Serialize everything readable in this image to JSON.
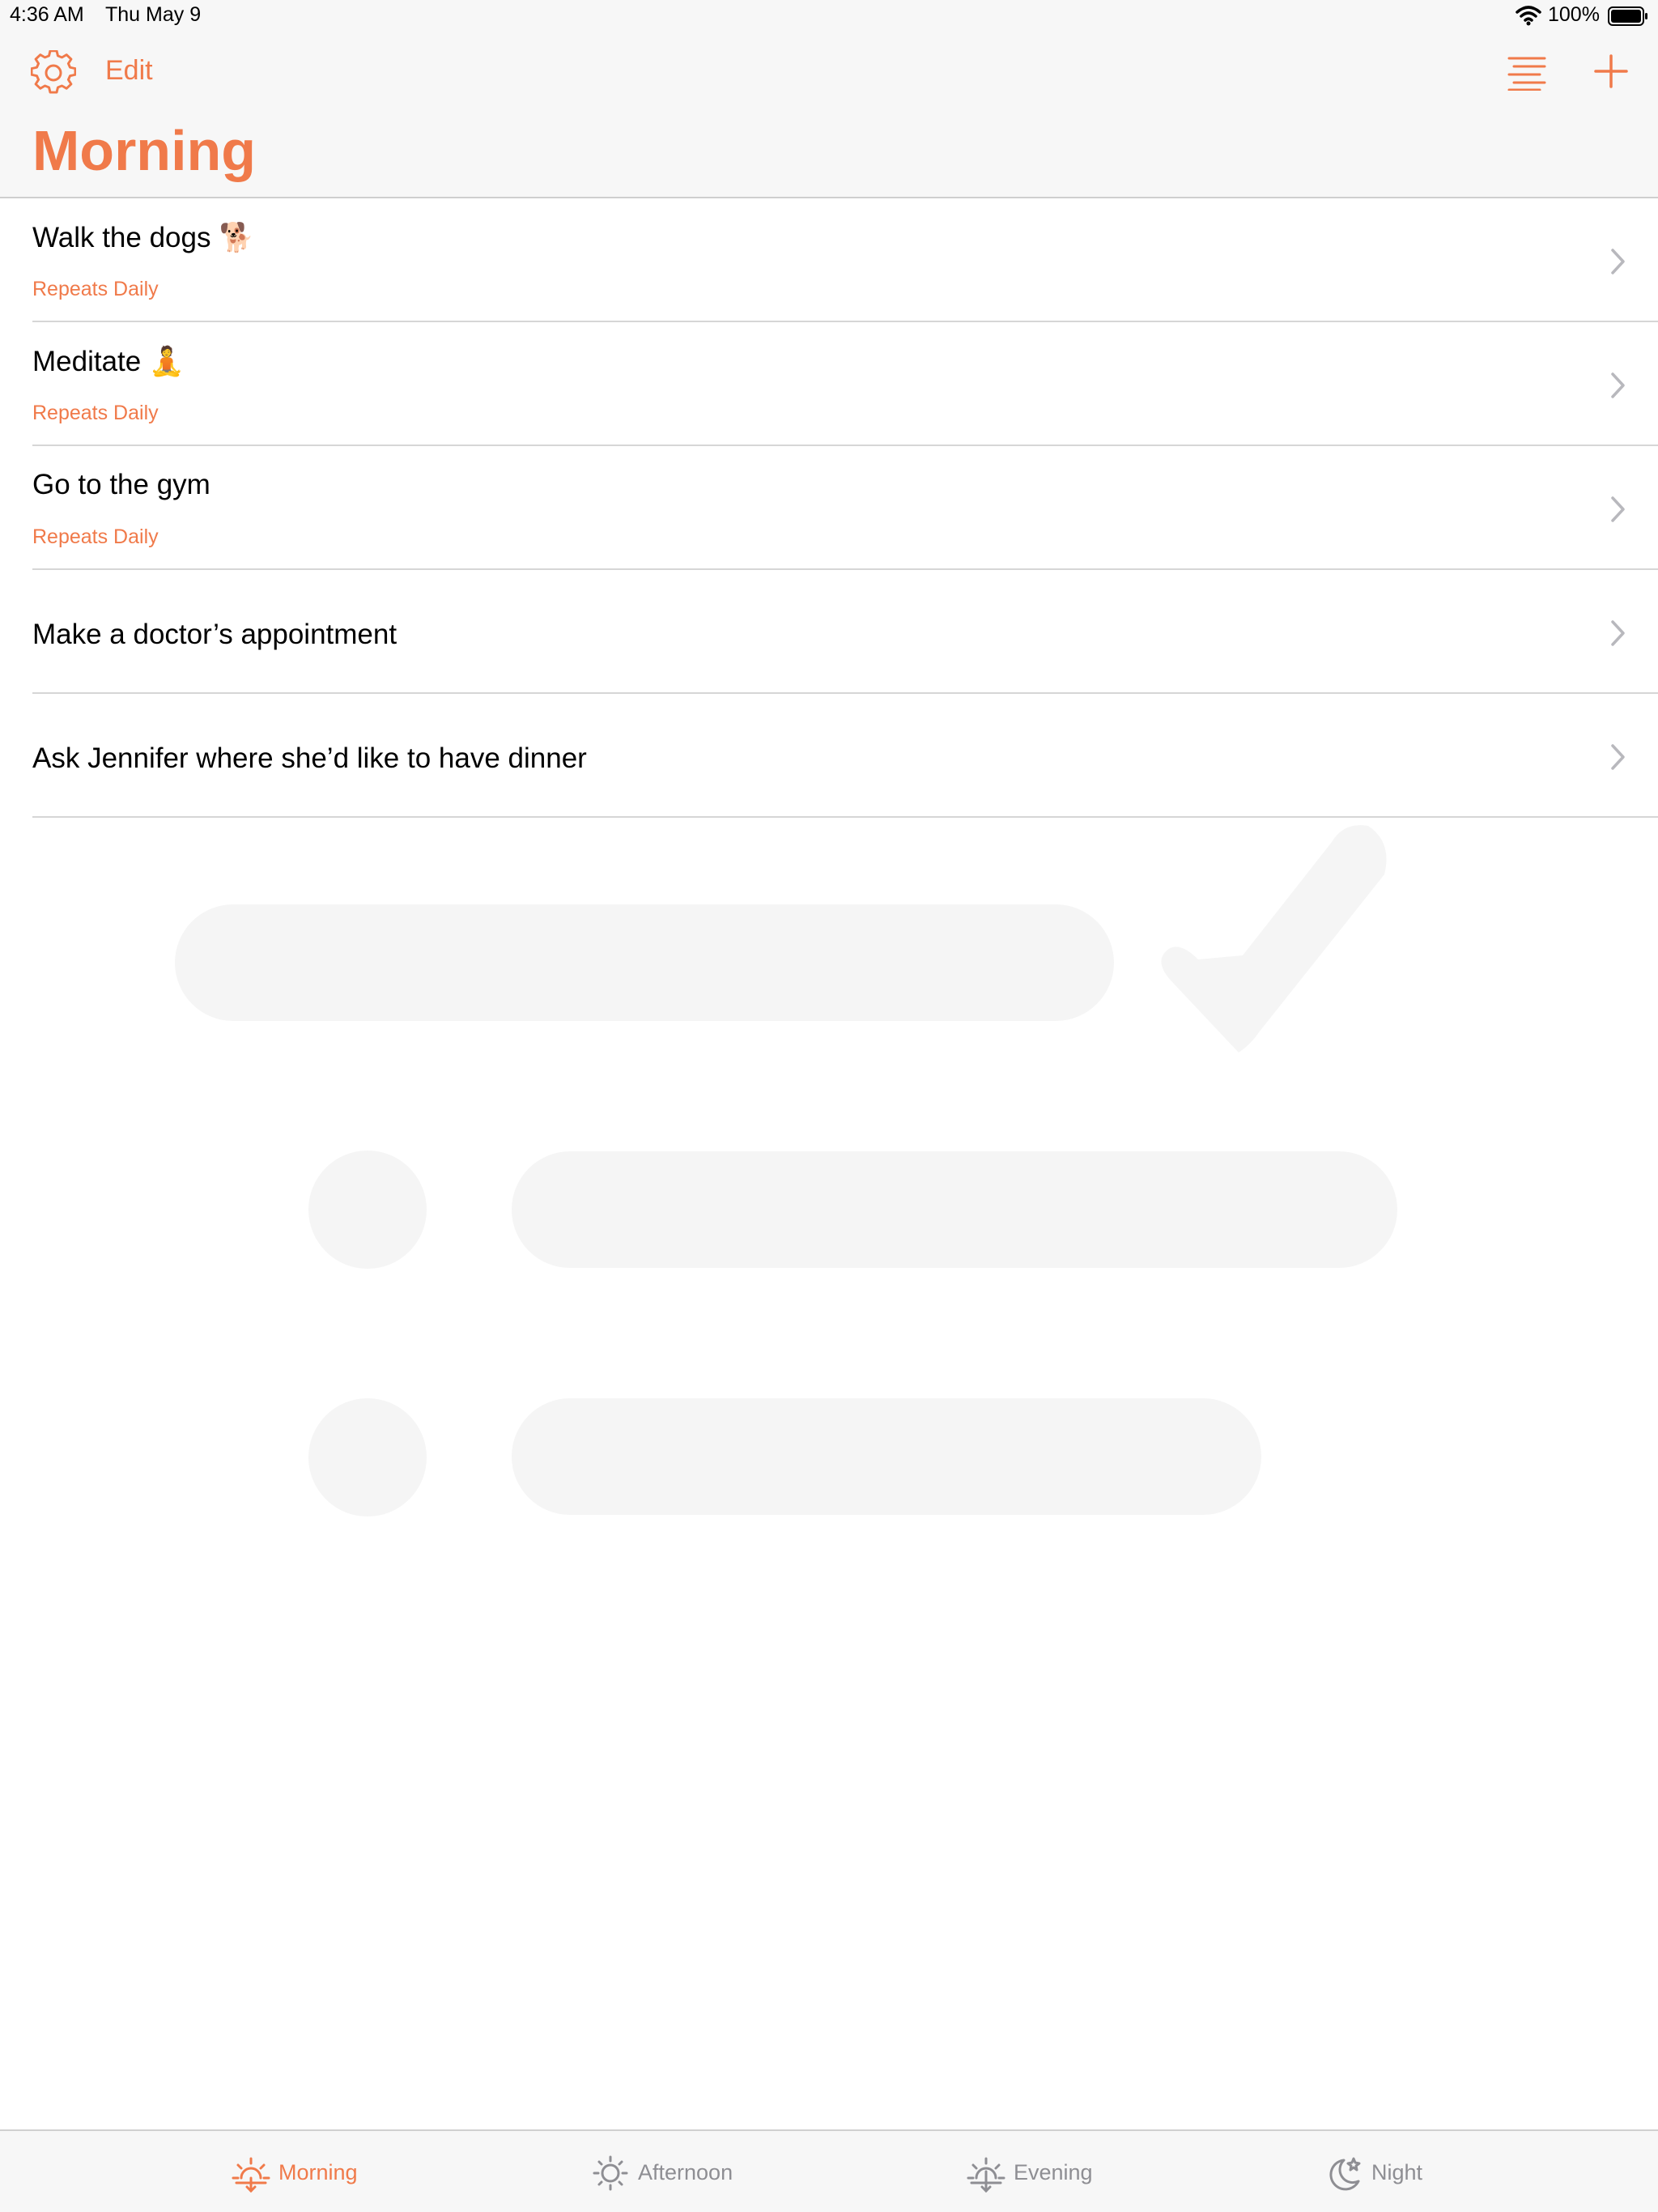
{
  "status_bar": {
    "time": "4:36 AM",
    "date": "Thu May 9",
    "battery_percent": "100%",
    "battery_level": 1.0,
    "icons": [
      "wifi-icon",
      "battery-icon"
    ]
  },
  "nav": {
    "settings_icon": "gear-icon",
    "edit_label": "Edit",
    "sort_icon": "list-sort-icon",
    "add_icon": "plus-icon",
    "title": "Morning"
  },
  "tasks": [
    {
      "title": "Walk the dogs",
      "emoji": "🐕",
      "subtitle": "Repeats Daily"
    },
    {
      "title": "Meditate",
      "emoji": "🧘",
      "subtitle": "Repeats Daily"
    },
    {
      "title": "Go to the gym",
      "emoji": "",
      "subtitle": "Repeats Daily"
    },
    {
      "title": "Make a doctor’s appointment",
      "emoji": "",
      "subtitle": ""
    },
    {
      "title": "Ask Jennifer where she’d like to have dinner",
      "emoji": "",
      "subtitle": ""
    }
  ],
  "tab_bar": {
    "tabs": [
      {
        "label": "Morning",
        "icon": "sunrise-icon",
        "active": true
      },
      {
        "label": "Afternoon",
        "icon": "sun-icon",
        "active": false
      },
      {
        "label": "Evening",
        "icon": "sunset-icon",
        "active": false
      },
      {
        "label": "Night",
        "icon": "moon-stars-icon",
        "active": false
      }
    ]
  },
  "colors": {
    "accent": "#f07a4a",
    "inactive": "#8e8e93",
    "bar_background": "#f7f7f7",
    "decor": "#f5f5f5"
  }
}
